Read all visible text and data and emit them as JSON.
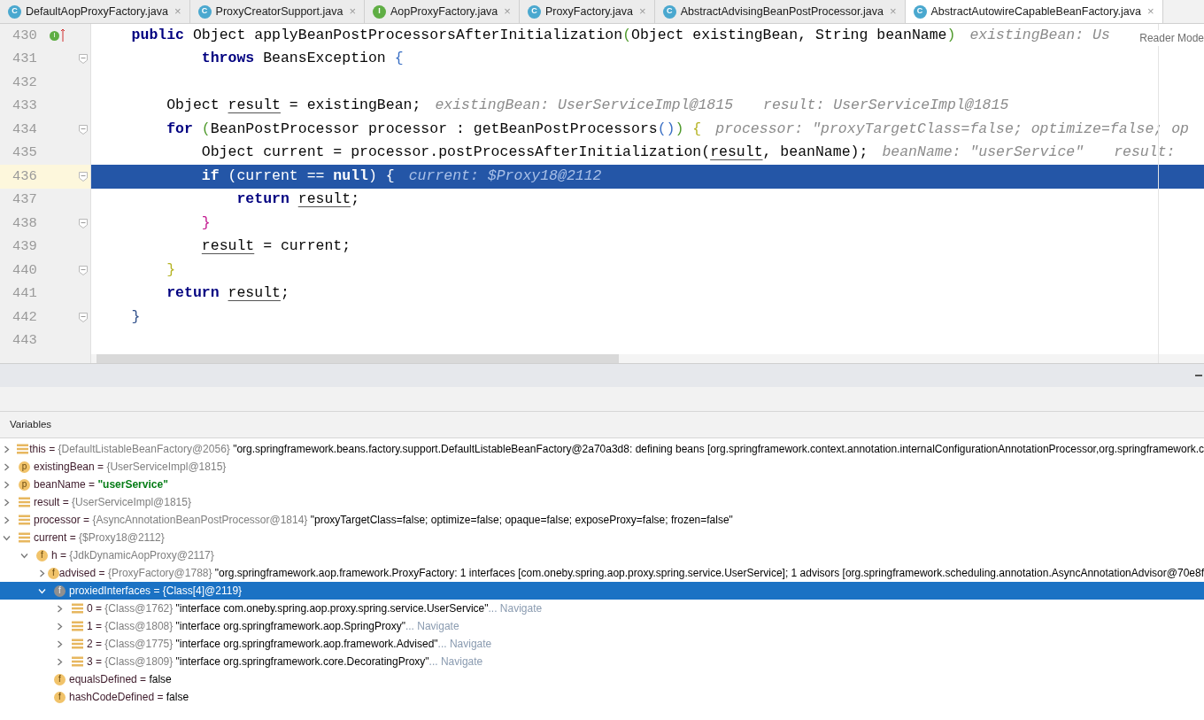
{
  "tabs": [
    {
      "badge": "C",
      "kind": "class",
      "label": "DefaultAopProxyFactory.java",
      "close": "×",
      "selected": false
    },
    {
      "badge": "C",
      "kind": "class",
      "label": "ProxyCreatorSupport.java",
      "close": "×",
      "selected": false
    },
    {
      "badge": "I",
      "kind": "interface",
      "label": "AopProxyFactory.java",
      "close": "×",
      "selected": false
    },
    {
      "badge": "C",
      "kind": "class",
      "label": "ProxyFactory.java",
      "close": "×",
      "selected": false
    },
    {
      "badge": "C",
      "kind": "class",
      "label": "AbstractAdvisingBeanPostProcessor.java",
      "close": "×",
      "selected": false
    },
    {
      "badge": "C",
      "kind": "class",
      "label": "AbstractAutowireCapableBeanFactory.java",
      "close": "×",
      "selected": true
    }
  ],
  "editor": {
    "reader_mode": "Reader Mode",
    "lines": [
      {
        "number": "430",
        "fold": false,
        "current": false,
        "gutter_badge": "I",
        "code": [
          {
            "kind": "kw",
            "text": "    public"
          },
          {
            "kind": "text",
            "text": " Object applyBeanPostProcessorsAfterInitialization"
          },
          {
            "kind": "brace",
            "text": "(",
            "color": "#4f9a2c"
          },
          {
            "kind": "text",
            "text": "Object existingBean, String beanName"
          },
          {
            "kind": "brace",
            "text": ")",
            "color": "#4f9a2c"
          }
        ],
        "hints": [
          "existingBean: Us"
        ]
      },
      {
        "number": "431",
        "fold": true,
        "current": false,
        "code": [
          {
            "kind": "kw",
            "text": "            throws"
          },
          {
            "kind": "text",
            "text": " BeansException "
          },
          {
            "kind": "brace",
            "text": "{",
            "color": "#3a6fc4"
          }
        ]
      },
      {
        "number": "432",
        "fold": false,
        "current": false
      },
      {
        "number": "433",
        "fold": false,
        "current": false,
        "code": [
          {
            "kind": "text",
            "text": "        Object "
          },
          {
            "kind": "var",
            "text": "result"
          },
          {
            "kind": "text",
            "text": " = existingBean;"
          }
        ],
        "hints": [
          "existingBean: UserServiceImpl@1815",
          "result: UserServiceImpl@1815"
        ]
      },
      {
        "number": "434",
        "fold": true,
        "current": false,
        "code": [
          {
            "kind": "kw",
            "text": "        for"
          },
          {
            "kind": "brace",
            "text": " (",
            "color": "#4f9a2c"
          },
          {
            "kind": "text",
            "text": "BeanPostProcessor processor : getBeanPostProcessors"
          },
          {
            "kind": "brace",
            "text": "()",
            "color": "#3a6fc4"
          },
          {
            "kind": "brace",
            "text": ")",
            "color": "#4f9a2c"
          },
          {
            "kind": "brace",
            "text": " {",
            "color": "#b5b324"
          }
        ],
        "hints": [
          "processor: \"proxyTargetClass=false; optimize=false; op"
        ]
      },
      {
        "number": "435",
        "fold": false,
        "current": false,
        "code": [
          {
            "kind": "text",
            "text": "            Object current = processor.postProcessAfterInitialization("
          },
          {
            "kind": "var",
            "text": "result"
          },
          {
            "kind": "text",
            "text": ", beanName);"
          }
        ],
        "hints": [
          "beanName: \"userService\"",
          "result:"
        ]
      },
      {
        "number": "436",
        "fold": true,
        "current": true,
        "code": [
          {
            "kind": "kw",
            "text": "            if"
          },
          {
            "kind": "text",
            "text": " (current == "
          },
          {
            "kind": "kw",
            "text": "null"
          },
          {
            "kind": "text",
            "text": ") {"
          }
        ],
        "hints": [
          "current: $Proxy18@2112"
        ]
      },
      {
        "number": "437",
        "fold": false,
        "current": false,
        "code": [
          {
            "kind": "kw",
            "text": "                return"
          },
          {
            "kind": "var",
            "text": " result"
          },
          {
            "kind": "text",
            "text": ";"
          }
        ]
      },
      {
        "number": "438",
        "fold": true,
        "current": false,
        "code": [
          {
            "kind": "brace",
            "text": "            }",
            "color": "#c2188f"
          }
        ]
      },
      {
        "number": "439",
        "fold": false,
        "current": false,
        "code": [
          {
            "kind": "var",
            "text": "            result"
          },
          {
            "kind": "text",
            "text": " = current;"
          }
        ]
      },
      {
        "number": "440",
        "fold": true,
        "current": false,
        "code": [
          {
            "kind": "brace",
            "text": "        }",
            "color": "#b5b324"
          }
        ]
      },
      {
        "number": "441",
        "fold": false,
        "current": false,
        "code": [
          {
            "kind": "kw",
            "text": "        return"
          },
          {
            "kind": "var",
            "text": " result"
          },
          {
            "kind": "text",
            "text": ";"
          }
        ]
      },
      {
        "number": "442",
        "fold": true,
        "current": false,
        "code": [
          {
            "kind": "brace",
            "text": "    }",
            "color": "#2f4f8a"
          }
        ]
      },
      {
        "number": "443",
        "fold": false,
        "current": false
      }
    ]
  },
  "variables": {
    "title": "Variables",
    "items": [
      {
        "kind": "local",
        "expanded": false,
        "selected": false,
        "name": "this =",
        "ref": "{DefaultListableBeanFactory@2056}",
        "value": "\"org.springframework.beans.factory.support.DefaultListableBeanFactory@2a70a3d8: defining beans [org.springframework.context.annotation.internalConfigurationAnnotationProcessor,org.springframework.c"
      },
      {
        "kind": "param",
        "badge": "p",
        "expanded": false,
        "selected": false,
        "name": "existingBean =",
        "ref": "{UserServiceImpl@1815}"
      },
      {
        "kind": "param",
        "badge": "p",
        "expanded": false,
        "selected": false,
        "name": "beanName =",
        "literal_value": "\"userService\""
      },
      {
        "kind": "local",
        "expanded": false,
        "selected": false,
        "name": "result =",
        "ref": "{UserServiceImpl@1815}"
      },
      {
        "kind": "local",
        "expanded": false,
        "selected": false,
        "name": "processor =",
        "ref": "{AsyncAnnotationBeanPostProcessor@1814}",
        "value": "\"proxyTargetClass=false; optimize=false; opaque=false; exposeProxy=false; frozen=false\""
      },
      {
        "kind": "local",
        "expanded": true,
        "selected": false,
        "name": "current =",
        "ref": "{$Proxy18@2112}",
        "children": [
          {
            "kind": "field",
            "badge": "f",
            "expanded": true,
            "selected": false,
            "name": "h =",
            "ref": "{JdkDynamicAopProxy@2117}",
            "children": [
              {
                "kind": "field",
                "badge": "f",
                "expanded": false,
                "selected": false,
                "name": "advised =",
                "ref": "{ProxyFactory@1788}",
                "value": "\"org.springframework.aop.framework.ProxyFactory: 1 interfaces [com.oneby.spring.aop.proxy.spring.service.UserService]; 1 advisors [org.springframework.scheduling.annotation.AsyncAnnotationAdvisor@70e8f"
              },
              {
                "kind": "field",
                "badge": "f",
                "expanded": true,
                "selected": true,
                "name": "proxiedInterfaces =",
                "ref": "{Class[4]@2119}",
                "children": [
                  {
                    "kind": "local",
                    "expanded": false,
                    "selected": false,
                    "name": "0 =",
                    "ref": "{Class@1762}",
                    "value": "\"interface com.oneby.spring.aop.proxy.spring.service.UserService\"",
                    "link": "... Navigate"
                  },
                  {
                    "kind": "local",
                    "expanded": false,
                    "selected": false,
                    "name": "1 =",
                    "ref": "{Class@1808}",
                    "value": "\"interface org.springframework.aop.SpringProxy\"",
                    "link": "... Navigate"
                  },
                  {
                    "kind": "local",
                    "expanded": false,
                    "selected": false,
                    "name": "2 =",
                    "ref": "{Class@1775}",
                    "value": "\"interface org.springframework.aop.framework.Advised\"",
                    "link": "... Navigate"
                  },
                  {
                    "kind": "local",
                    "expanded": false,
                    "selected": false,
                    "name": "3 =",
                    "ref": "{Class@1809}",
                    "value": "\"interface org.springframework.core.DecoratingProxy\"",
                    "link": "... Navigate"
                  }
                ]
              },
              {
                "kind": "field",
                "badge": "f",
                "selected": false,
                "name": "equalsDefined =",
                "value": "false"
              },
              {
                "kind": "field",
                "badge": "f",
                "selected": false,
                "name": "hashCodeDefined =",
                "value": "false"
              }
            ]
          }
        ]
      }
    ]
  }
}
